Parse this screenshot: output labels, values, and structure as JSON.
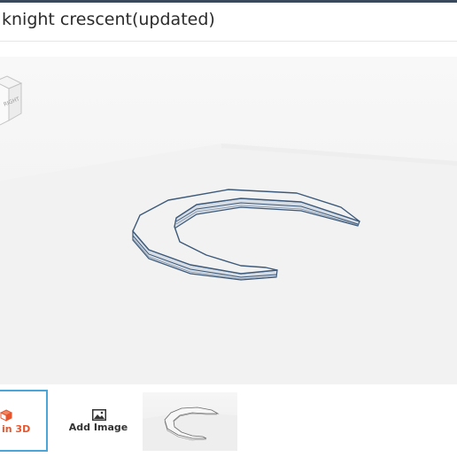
{
  "header": {
    "title": "knight crescent(updated)"
  },
  "viewcube": {
    "face_label": "RIGHT"
  },
  "thumbnails": {
    "view_3d_label": "in 3D",
    "add_image_label": "Add Image"
  },
  "colors": {
    "accent_orange": "#e8552d",
    "selected_border": "#4aa6d8",
    "model_edge": "#3d5a7a",
    "model_fill": "#f2f2f2"
  }
}
